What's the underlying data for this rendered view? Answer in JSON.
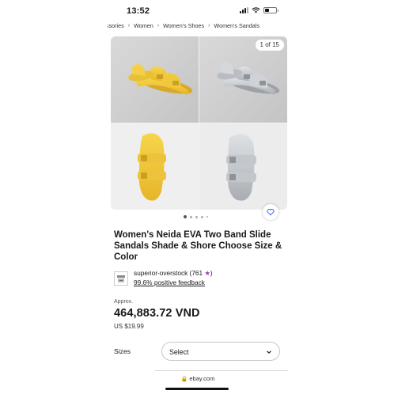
{
  "status_bar": {
    "time": "13:52"
  },
  "breadcrumb": [
    "essories",
    "Women",
    "Women's Shoes",
    "Women's Sandals"
  ],
  "gallery": {
    "counter": "1 of 15",
    "dots_total": 5,
    "dots_active_index": 0
  },
  "listing": {
    "title": "Women's Neida EVA Two Band Slide Sandals  Shade & Shore Choose Size & Color"
  },
  "seller": {
    "name": "superior-overstock",
    "score_open": " (761 ",
    "score_close": ")",
    "feedback": "99.6% positive feedback"
  },
  "price": {
    "approx_label": "Approx.",
    "local": "464,883.72 VND",
    "usd": "US $19.99"
  },
  "variation": {
    "label": "Sizes",
    "value": "Select"
  },
  "browser": {
    "url": "ebay.com"
  },
  "colors": {
    "yellow_sandal": "#f4ce3c",
    "silver_sandal": "#c9ccd0",
    "star": "#8e3fbf"
  }
}
